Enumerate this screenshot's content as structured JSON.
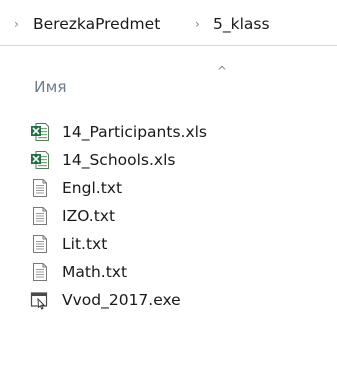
{
  "breadcrumb": {
    "separator": "›",
    "items": [
      "BerezkaPredmet",
      "5_klass"
    ]
  },
  "column_header": {
    "name_label": "Имя",
    "sort_indicator": "^"
  },
  "files": [
    {
      "name": "14_Participants.xls",
      "icon": "excel-file-icon"
    },
    {
      "name": "14_Schools.xls",
      "icon": "excel-file-icon"
    },
    {
      "name": "Engl.txt",
      "icon": "text-file-icon"
    },
    {
      "name": "IZO.txt",
      "icon": "text-file-icon"
    },
    {
      "name": "Lit.txt",
      "icon": "text-file-icon"
    },
    {
      "name": "Math.txt",
      "icon": "text-file-icon"
    },
    {
      "name": "Vvod_2017.exe",
      "icon": "executable-file-icon"
    }
  ],
  "colors": {
    "excel_green": "#1e7145",
    "header_text": "#6d7d8b"
  }
}
